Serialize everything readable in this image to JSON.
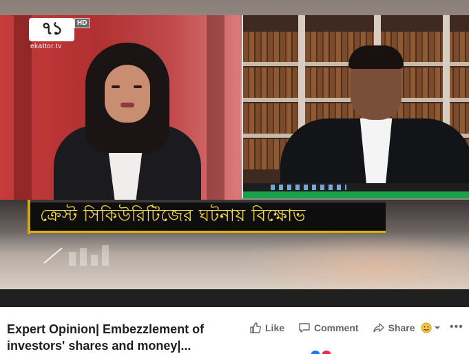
{
  "video": {
    "logo": {
      "mark": "৭১",
      "badge": "HD",
      "url": "ekattor.tv"
    },
    "headline": "ক্রেস্ট সিকিউরিটিজের ঘটনায় বিক্ষোভ"
  },
  "post": {
    "title": "Expert Opinion| Embezzlement of investors' shares and money|...",
    "actions": {
      "like": "Like",
      "comment": "Comment",
      "share": "Share"
    },
    "more": "•••"
  },
  "icons": {
    "like": "thumbs-up-icon",
    "comment": "comment-bubble-icon",
    "share": "share-arrow-icon",
    "reaction": "reaction-selector-icon",
    "more": "more-options-icon"
  },
  "colors": {
    "headline_text": "#f3d54a",
    "anchor_backdrop": "#c63b3c",
    "action_text": "#606770",
    "title_text": "#1c1e21"
  }
}
